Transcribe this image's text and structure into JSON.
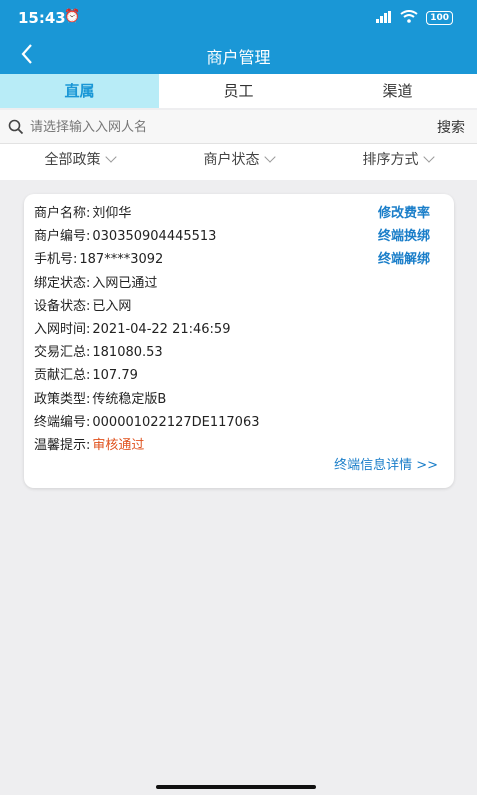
{
  "status_bar": {
    "time": "15:43",
    "battery": "100"
  },
  "header": {
    "title": "商户管理"
  },
  "tabs": [
    {
      "label": "直属",
      "active": true
    },
    {
      "label": "员工",
      "active": false
    },
    {
      "label": "渠道",
      "active": false
    }
  ],
  "search": {
    "placeholder": "请选择输入入网人名",
    "button": "搜索"
  },
  "filters": [
    "全部政策",
    "商户状态",
    "排序方式"
  ],
  "merchant": {
    "fields": [
      {
        "label": "商户名称:",
        "value": "刘仰华"
      },
      {
        "label": "商户编号:",
        "value": "030350904445513"
      },
      {
        "label": "手机号:",
        "value": "187****3092"
      },
      {
        "label": "绑定状态:",
        "value": "入网已通过"
      },
      {
        "label": "设备状态:",
        "value": "已入网"
      },
      {
        "label": "入网时间:",
        "value": "2021-04-22 21:46:59"
      },
      {
        "label": "交易汇总:",
        "value": "181080.53"
      },
      {
        "label": "贡献汇总:",
        "value": "107.79"
      },
      {
        "label": "政策类型:",
        "value": "传统稳定版B"
      },
      {
        "label": "终端编号:",
        "value": "000001022127DE117063"
      },
      {
        "label": "温馨提示:",
        "value": "审核通过"
      }
    ],
    "actions": [
      "修改费率",
      "终端换绑",
      "终端解绑"
    ],
    "detail_link": "终端信息详情 >>"
  },
  "colors": {
    "header": "#1a97d6",
    "tab_active_bg": "#b8ecf7",
    "link": "#1a7ec9",
    "status": "#e0531f"
  }
}
